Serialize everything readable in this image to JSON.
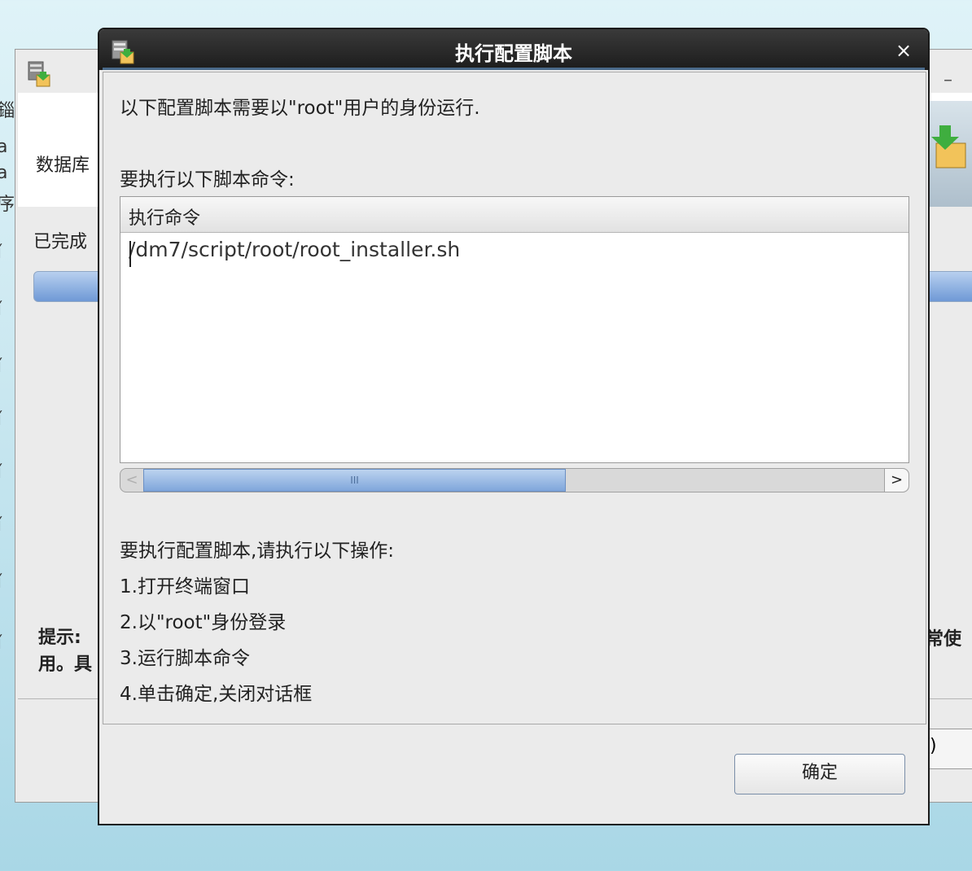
{
  "background_window": {
    "header_label": "数据库",
    "done_label": "已完成",
    "hint_line1": "提示:",
    "hint_line2": "用。具",
    "hint_right": "常使",
    "partial_button": ")",
    "left_strip_chars": [
      "錙",
      "a",
      "a",
      "序",
      "ǐ",
      "ǐ",
      "ǐ",
      "ǐ",
      "ǐ",
      "ǐ",
      "ǐ",
      "ǐ"
    ]
  },
  "dialog": {
    "title": "执行配置脚本",
    "close_glyph": "×",
    "intro": "以下配置脚本需要以\"root\"用户的身份运行.",
    "command_label": "要执行以下脚本命令:",
    "table": {
      "column_header": "执行命令",
      "rows": [
        "/dm7/script/root/root_installer.sh"
      ]
    },
    "scrollbar": {
      "left_arrow": "<",
      "thumb_grip": "III",
      "right_arrow": ">",
      "thumb_fraction": 0.57
    },
    "steps_heading": "要执行配置脚本,请执行以下操作:",
    "steps": [
      "1.打开终端窗口",
      "2.以\"root\"身份登录",
      "3.运行脚本命令",
      "4.单击确定,关闭对话框"
    ],
    "ok_button": "确定"
  },
  "icons": {
    "dialog_title_icon": "installer-icon",
    "background_title_icon": "installer-icon",
    "close": "close-icon"
  }
}
